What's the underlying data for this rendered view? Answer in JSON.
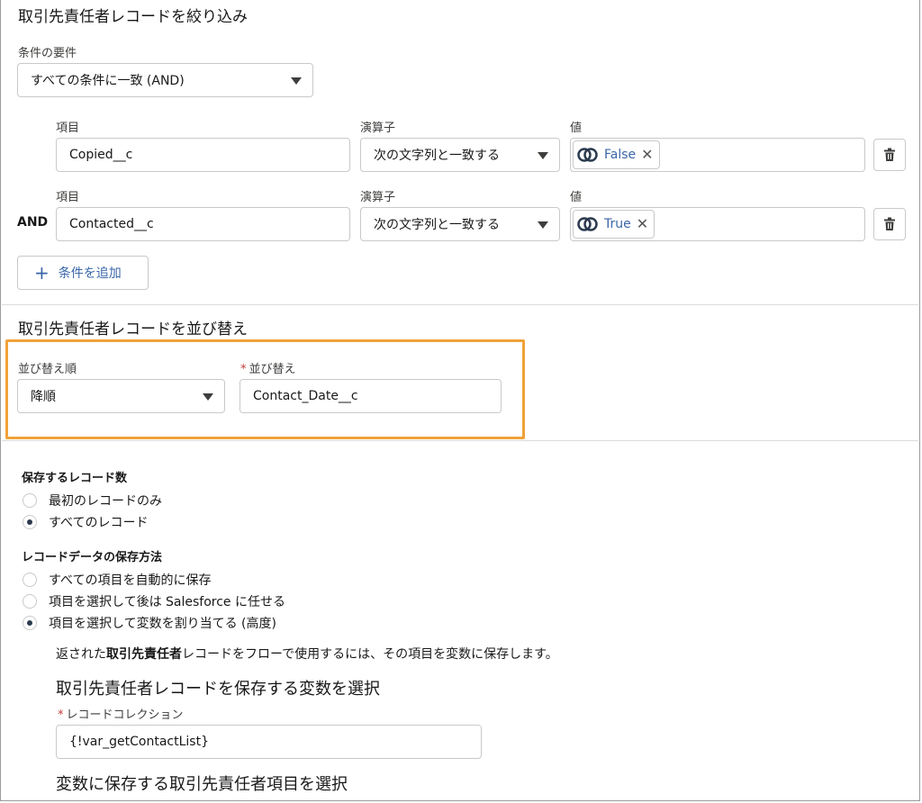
{
  "filter": {
    "title": "取引先責任者レコードを絞り込み",
    "requirement_label": "条件の要件",
    "requirement_value": "すべての条件に一致 (AND)",
    "rows": [
      {
        "prefix": "",
        "field_label": "項目",
        "field": "Copied__c",
        "operator_label": "演算子",
        "operator": "次の文字列と一致する",
        "value_label": "値",
        "value": "False"
      },
      {
        "prefix": "AND",
        "field_label": "項目",
        "field": "Contacted__c",
        "operator_label": "演算子",
        "operator": "次の文字列と一致する",
        "value_label": "値",
        "value": "True"
      }
    ],
    "add_condition": "条件を追加"
  },
  "sort": {
    "title": "取引先責任者レコードを並び替え",
    "order_label": "並び替え順",
    "order_value": "降順",
    "field_label": "並び替え",
    "field_value": "Contact_Date__c",
    "highlight_color": "#f0a23a"
  },
  "records": {
    "title": "保存するレコード数",
    "options": [
      "最初のレコードのみ",
      "すべてのレコード"
    ],
    "selected": 1
  },
  "storage": {
    "title": "レコードデータの保存方法",
    "options": [
      "すべての項目を自動的に保存",
      "項目を選択して後は Salesforce に任せる",
      "項目を選択して変数を割り当てる (高度)"
    ],
    "selected": 2
  },
  "variables": {
    "help_prefix": "返された",
    "help_bold": "取引先責任者",
    "help_suffix": "レコードをフローで使用するには、その項目を変数に保存します。",
    "select_title": "取引先責任者レコードを保存する変数を選択",
    "collection_label": "レコードコレクション",
    "collection_value": "{!var_getContactList}",
    "fields_title": "変数に保存する取引先責任者項目を選択"
  }
}
